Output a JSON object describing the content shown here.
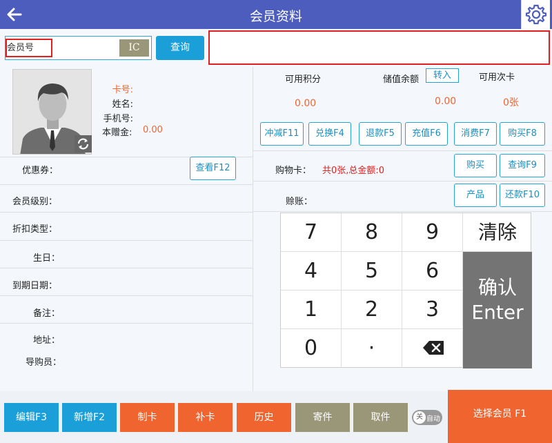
{
  "header": {
    "title": "会员资料"
  },
  "search": {
    "placeholder": "会员号",
    "ic_label": "IC",
    "query_label": "查询"
  },
  "member": {
    "card_no_label": "卡号:",
    "name_label": "姓名:",
    "phone_label": "手机号:",
    "gift_label": "本赠金:",
    "gift_value": "0.00"
  },
  "fields": {
    "coupon_label": "优惠券：",
    "view_button": "查看F12",
    "level_label": "会员级别：",
    "discount_label": "折扣类型：",
    "birthday_label": "生日：",
    "expiry_label": "到期日期：",
    "note_label": "备注：",
    "address_label": "地址：",
    "guide_label": "导购员："
  },
  "stats": {
    "points_label": "可用积分",
    "points_value": "0.00",
    "balance_label": "储值余额",
    "transfer_label": "转入",
    "balance_value": "0.00",
    "times_label": "可用次卡",
    "times_value": "0张"
  },
  "actions": {
    "offset": "冲减F11",
    "exchange": "兑换F4",
    "refund": "退款F5",
    "recharge": "充值F6",
    "consume": "消费F7",
    "buy": "购买F8"
  },
  "shopping": {
    "label": "购物卡：",
    "summary": "共0张,总金额:0",
    "buy": "购买",
    "query": "查询F9"
  },
  "credit": {
    "label": "赊账：",
    "product": "产品",
    "repay": "还款F10"
  },
  "keypad": {
    "k7": "7",
    "k8": "8",
    "k9": "9",
    "clear": "清除",
    "k4": "4",
    "k5": "5",
    "k6": "6",
    "k1": "1",
    "k2": "2",
    "k3": "3",
    "k0": "0",
    "dot": "·",
    "confirm": "确认",
    "enter": "Enter"
  },
  "bottom": {
    "edit": "编辑F3",
    "add": "新增F2",
    "make_card": "制卡",
    "reissue": "补卡",
    "history": "历史",
    "send": "寄件",
    "pickup": "取件",
    "toggle_off": "关",
    "toggle_auto": "自动",
    "select_member": "选择会员 F1"
  },
  "colors": {
    "header": "#4d5dbd",
    "accent": "#1a9fd9",
    "orange": "#f0652f",
    "olive": "#9a9778",
    "alert": "#e02020"
  }
}
